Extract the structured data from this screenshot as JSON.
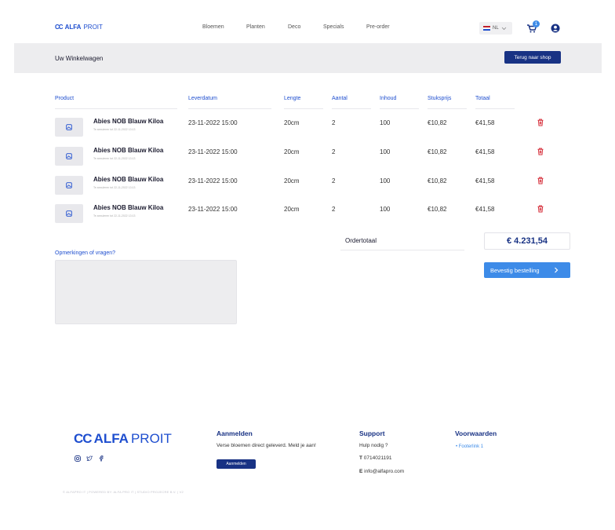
{
  "brand": {
    "mark": "CC",
    "name_bold": "ALFA",
    "name_light": "PROIT"
  },
  "nav": {
    "menu": [
      "Bloemen",
      "Planten",
      "Deco",
      "Specials",
      "Pre-order"
    ],
    "language": "NL",
    "cart_count": "1"
  },
  "banner": {
    "title": "Uw Winkelwagen",
    "back_label": "Terug naar shop"
  },
  "table": {
    "headers": [
      "Product",
      "Leverdatum",
      "Lengte",
      "Aantal",
      "Inhoud",
      "Stuksprijs",
      "Totaal"
    ],
    "rows": [
      {
        "name": "Abies NOB Blauw Kiloa",
        "sub": "Te annuleren tot 22-11-2022 13:13",
        "date": "23-11-2022 15:00",
        "length": "20cm",
        "qty": "2",
        "content": "100",
        "unit": "€10,82",
        "total": "€41,58"
      },
      {
        "name": "Abies NOB Blauw Kiloa",
        "sub": "Te annuleren tot 22-11-2022 13:13",
        "date": "23-11-2022 15:00",
        "length": "20cm",
        "qty": "2",
        "content": "100",
        "unit": "€10,82",
        "total": "€41,58"
      },
      {
        "name": "Abies NOB Blauw Kiloa",
        "sub": "Te annuleren tot 22-11-2022 13:13",
        "date": "23-11-2022 15:00",
        "length": "20cm",
        "qty": "2",
        "content": "100",
        "unit": "€10,82",
        "total": "€41,58"
      },
      {
        "name": "Abies NOB Blauw Kiloa",
        "sub": "Te annuleren tot 22-11-2022 13:13",
        "date": "23-11-2022 15:00",
        "length": "20cm",
        "qty": "2",
        "content": "100",
        "unit": "€10,82",
        "total": "€41,58"
      }
    ]
  },
  "order": {
    "total_label": "Ordertotaal",
    "total_value": "€ 4.231,54",
    "confirm_label": "Bevestig bestelling"
  },
  "remarks": {
    "label": "Opmerkingen of vragen?"
  },
  "footer": {
    "signup": {
      "heading": "Aanmelden",
      "text": "Verse bloemen direct geleverd. Meld je aan!",
      "button": "Aanmelden"
    },
    "support": {
      "heading": "Support",
      "help": "Hulp nodig ?",
      "phone_key": "T",
      "phone": "0714021191",
      "email_key": "E",
      "email": "info@alfapro.com"
    },
    "terms": {
      "heading": "Voorwaarden",
      "link": "• Footerlink 1"
    },
    "copyright": "© ALFAPRO IT | POWERED BY: ALFA PRO IT | STUDIO PROJECRE B.V. | V2"
  },
  "colors": {
    "primary_dark": "#183284",
    "primary": "#1e4ecf",
    "accent": "#3d8be8",
    "danger": "#d6303c"
  },
  "icons": {
    "cart": "cart-icon",
    "user": "user-icon",
    "trash": "trash-icon",
    "image": "image-placeholder-icon",
    "chevron": "chevron-right-icon"
  }
}
